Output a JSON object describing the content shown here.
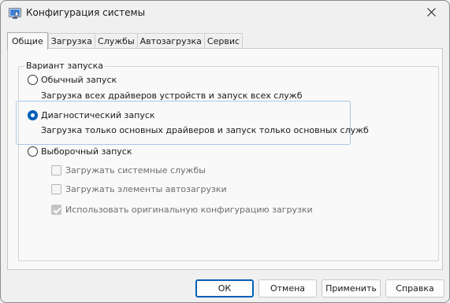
{
  "window": {
    "title": "Конфигурация системы",
    "icon": "system-config-icon"
  },
  "tabs": [
    {
      "label": "Общие",
      "active": true
    },
    {
      "label": "Загрузка",
      "active": false
    },
    {
      "label": "Службы",
      "active": false
    },
    {
      "label": "Автозагрузка",
      "active": false
    },
    {
      "label": "Сервис",
      "active": false
    }
  ],
  "group": {
    "legend": "Вариант запуска",
    "options": [
      {
        "label": "Обычный запуск",
        "description": "Загрузка всех драйверов устройств и запуск всех служб",
        "selected": false
      },
      {
        "label": "Диагностический запуск",
        "description": "Загрузка только основных драйверов и запуск только основных служб",
        "selected": true
      },
      {
        "label": "Выборочный запуск",
        "selected": false
      }
    ],
    "selective_options": [
      {
        "label": "Загружать системные службы",
        "checked": false,
        "enabled": false
      },
      {
        "label": "Загружать элементы автозагрузки",
        "checked": false,
        "enabled": false
      },
      {
        "label": "Использовать оригинальную конфигурацию загрузки",
        "checked": true,
        "enabled": false
      }
    ]
  },
  "buttons": {
    "ok": "ОК",
    "cancel": "Отмена",
    "apply": "Применить",
    "help": "Справка"
  },
  "colors": {
    "accent": "#005fb8",
    "focus_border": "#a7c7e7",
    "disabled_text": "#6d6d6d"
  }
}
